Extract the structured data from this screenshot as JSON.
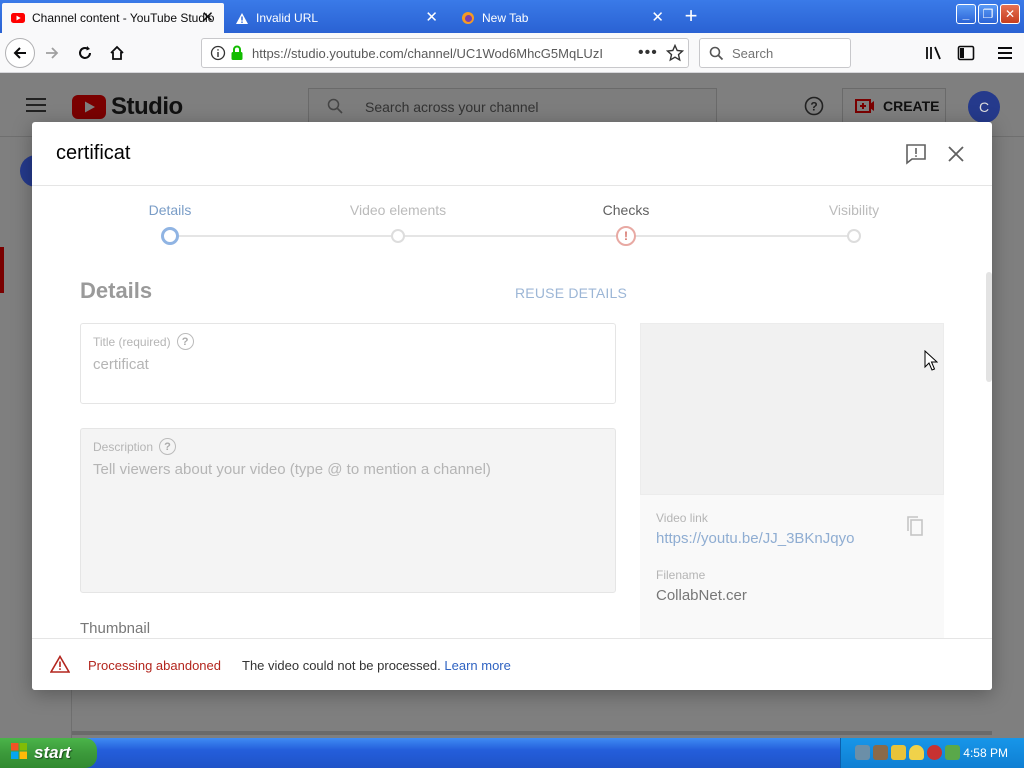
{
  "browser": {
    "tabs": [
      {
        "label": "Channel content - YouTube Studio",
        "icon": "youtube-icon"
      },
      {
        "label": "Invalid URL",
        "icon": "warning-icon"
      },
      {
        "label": "New Tab",
        "icon": "firefox-icon"
      }
    ],
    "url": "https://studio.youtube.com/channel/UC1Wod6MhcG5MqLUzI",
    "search_placeholder": "Search"
  },
  "studio": {
    "logo_text": "Studio",
    "search_placeholder": "Search across your channel",
    "create_label": "CREATE",
    "avatar_letter": "C"
  },
  "dialog": {
    "title": "certificat",
    "steps": [
      {
        "label": "Details",
        "state": "active"
      },
      {
        "label": "Video elements",
        "state": "pending"
      },
      {
        "label": "Checks",
        "state": "error"
      },
      {
        "label": "Visibility",
        "state": "pending"
      }
    ],
    "section_title": "Details",
    "reuse_label": "REUSE DETAILS",
    "title_field": {
      "label": "Title (required)",
      "value": "certificat"
    },
    "description_field": {
      "label": "Description",
      "placeholder": "Tell viewers about your video (type @ to mention a channel)"
    },
    "thumbnail_label": "Thumbnail",
    "video_link_label": "Video link",
    "video_link": "https://youtu.be/JJ_3BKnJqyo",
    "filename_label": "Filename",
    "filename": "CollabNet.cer",
    "footer": {
      "status": "Processing abandoned",
      "message": "The video could not be processed.",
      "link": "Learn more"
    }
  },
  "taskbar": {
    "start_label": "start",
    "clock": "4:58 PM"
  },
  "colors": {
    "accent_blue": "#2f63c2",
    "error_red": "#b3261e",
    "youtube_red": "#ff0000",
    "xp_blue": "#245edb",
    "xp_green": "#3c9a3b"
  }
}
